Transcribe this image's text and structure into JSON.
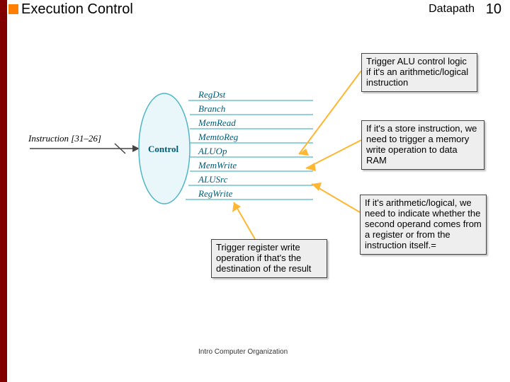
{
  "header": {
    "title": "Execution Control",
    "right_label": "Datapath",
    "page_number": "10"
  },
  "diagram": {
    "instruction_label": "Instruction [31–26]",
    "control_label": "Control",
    "signals": [
      "RegDst",
      "Branch",
      "MemRead",
      "MemtoReg",
      "ALUOp",
      "MemWrite",
      "ALUSrc",
      "RegWrite"
    ]
  },
  "notes": {
    "n1": "Trigger ALU control logic if it's an arithmetic/logical instruction",
    "n2": "If it's a store instruction, we need to trigger a memory write operation to data RAM",
    "n3": "If it's arithmetic/logical, we need to indicate whether the second operand comes from a register or from the instruction itself.=",
    "n4": "Trigger register write operation if that's the destination of the result"
  },
  "footer": "Intro Computer Organization"
}
